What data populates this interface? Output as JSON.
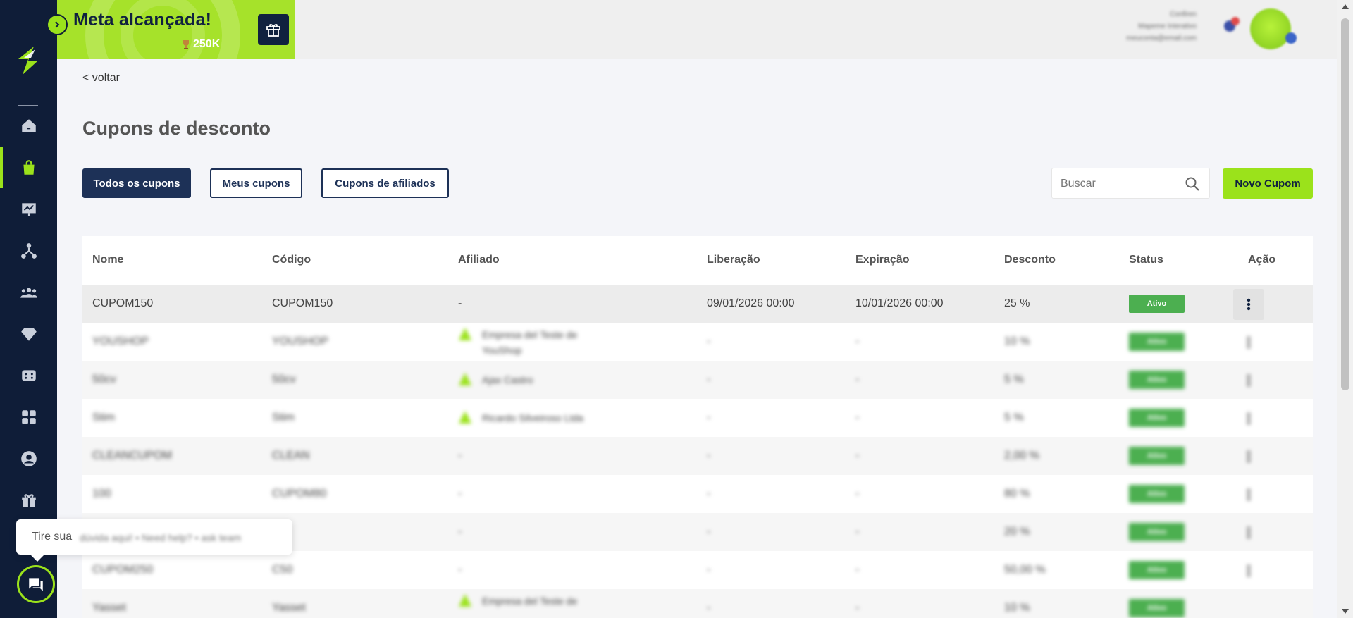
{
  "goal": {
    "title": "Meta alcançada!",
    "amount": "250K"
  },
  "user": {
    "name": "Confiren",
    "line2": "Mapeme Interativo",
    "line3": "meuconta@email.com"
  },
  "nav": {
    "back": "< voltar"
  },
  "page": {
    "title": "Cupons de desconto"
  },
  "filters": {
    "all": "Todos os cupons",
    "mine": "Meus cupons",
    "affiliates": "Cupons de afiliados"
  },
  "search": {
    "placeholder": "Buscar"
  },
  "actions": {
    "new_coupon": "Novo Cupom"
  },
  "table": {
    "headers": [
      "Nome",
      "Código",
      "Afiliado",
      "Liberação",
      "Expiração",
      "Desconto",
      "Status",
      "Ação"
    ],
    "rows": [
      {
        "name": "CUPOM150",
        "code": "CUPOM150",
        "affiliate": "-",
        "release": "09/01/2026 00:00",
        "expiry": "10/01/2026 00:00",
        "discount": "25 %",
        "status": "Ativo"
      },
      {
        "name": "YOUSHOP",
        "code": "YOUSHOP",
        "affiliate": "Empresa del Teste de YouShop",
        "release": "-",
        "expiry": "-",
        "discount": "10 %",
        "status": "Ativo"
      },
      {
        "name": "50cv",
        "code": "50cv",
        "affiliate": "Ajax Castro",
        "release": "-",
        "expiry": "-",
        "discount": "5 %",
        "status": "Ativo"
      },
      {
        "name": "Stim",
        "code": "Stim",
        "affiliate": "Ricardo Silveiroso Ltda",
        "release": "-",
        "expiry": "-",
        "discount": "5 %",
        "status": "Ativo"
      },
      {
        "name": "CLEANCUPOM",
        "code": "CLEAN",
        "affiliate": "-",
        "release": "-",
        "expiry": "-",
        "discount": "2,00 %",
        "status": "Ativo"
      },
      {
        "name": "100",
        "code": "CUPOM80",
        "affiliate": "-",
        "release": "-",
        "expiry": "-",
        "discount": "80 %",
        "status": "Ativo"
      },
      {
        "name": "",
        "code": "",
        "affiliate": "-",
        "release": "-",
        "expiry": "-",
        "discount": "20 %",
        "status": "Ativo"
      },
      {
        "name": "CUPOM250",
        "code": "C50",
        "affiliate": "-",
        "release": "-",
        "expiry": "-",
        "discount": "50,00 %",
        "status": "Ativo"
      },
      {
        "name": "Yasset",
        "code": "Yasset",
        "affiliate": "Empresa del Teste de",
        "release": "-",
        "expiry": "-",
        "discount": "10 %",
        "status": "Ativo"
      }
    ]
  },
  "help": {
    "lead": "Tire sua",
    "rest": "dúvida aqui! • Need help? • ask team"
  },
  "colors": {
    "sidebar": "#0f1d38",
    "accent": "#9be21b",
    "primary": "#1d3157",
    "status_active": "#4caf50"
  }
}
